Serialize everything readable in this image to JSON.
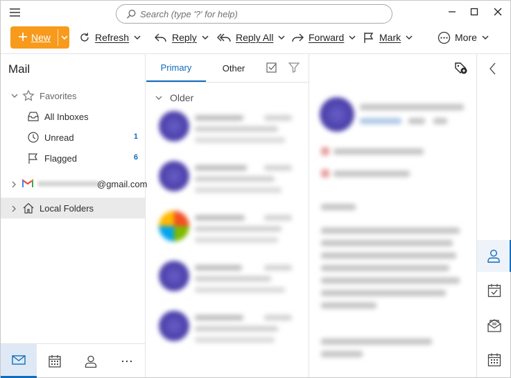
{
  "search": {
    "placeholder": "Search (type '?' for help)"
  },
  "toolbar": {
    "new_label": "New",
    "refresh_label": "Refresh",
    "reply_label": "Reply",
    "reply_all_label": "Reply All",
    "forward_label": "Forward",
    "mark_label": "Mark",
    "more_label": "More"
  },
  "sidebar": {
    "title": "Mail",
    "favorites_label": "Favorites",
    "items": [
      {
        "label": "All Inboxes",
        "icon": "inbox-icon"
      },
      {
        "label": "Unread",
        "icon": "clock-icon",
        "count": "1"
      },
      {
        "label": "Flagged",
        "icon": "flag-icon",
        "count": "6"
      }
    ],
    "account_label": "@gmail.com",
    "local_folders_label": "Local Folders"
  },
  "list": {
    "tabs": [
      "Primary",
      "Other"
    ],
    "group_label": "Older"
  },
  "colors": {
    "accent": "#0f6cbd",
    "new_button": "#f89a1c",
    "count": "#0f6cbd"
  }
}
